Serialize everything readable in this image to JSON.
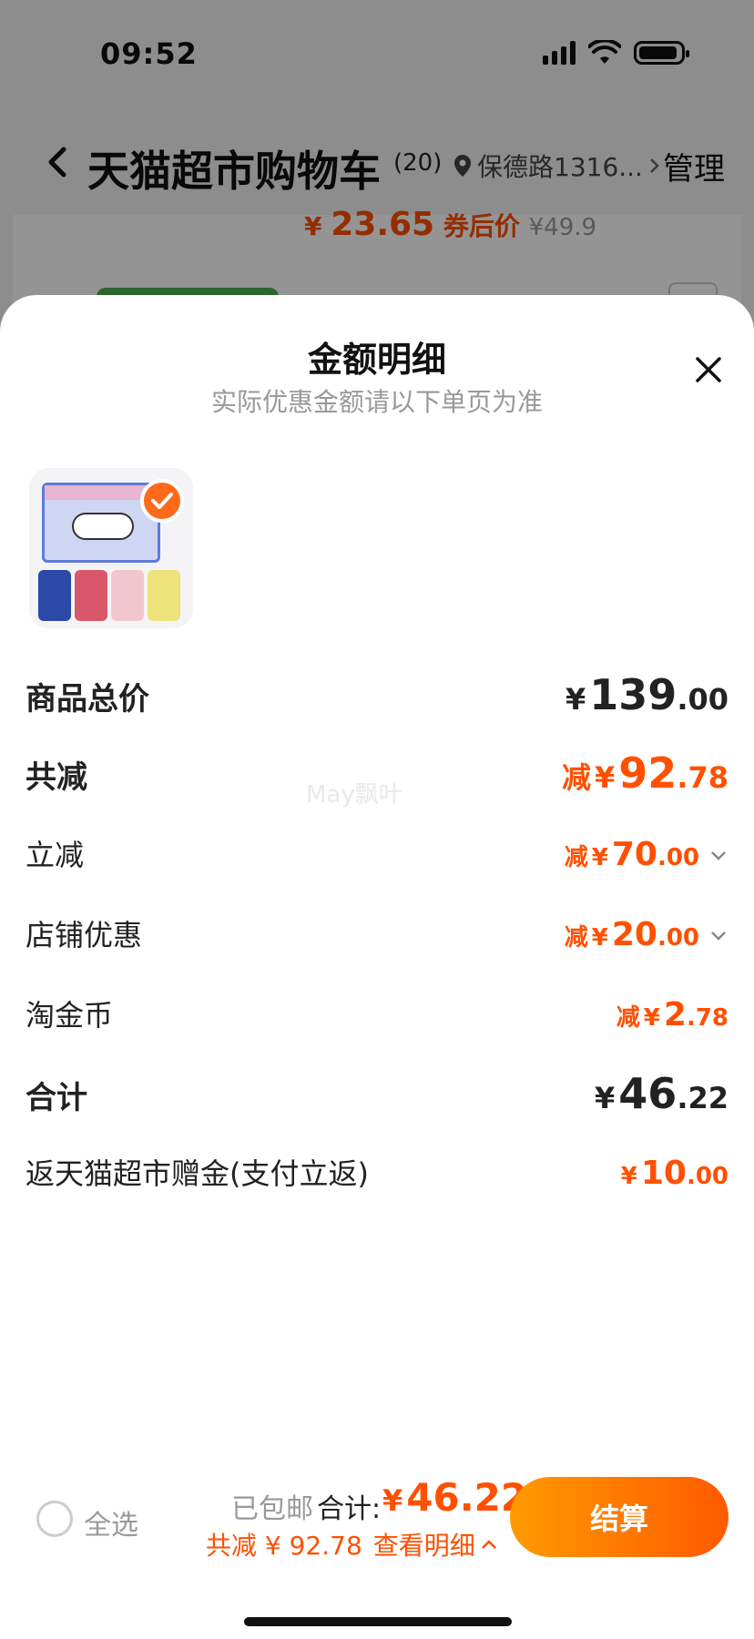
{
  "status_bar": {
    "time": "09:52"
  },
  "nav": {
    "title": "天猫超市购物车",
    "count": "(20)",
    "location": "保德路1316...",
    "manage": "管理"
  },
  "background_item": {
    "price_yen": "¥",
    "price_main": "23.65",
    "coupon_label": "券后价",
    "original_price": "¥49.9"
  },
  "sheet": {
    "title": "金额明细",
    "subtitle": "实际优惠金额请以下单页为准",
    "watermark": "May飘叶",
    "rows": [
      {
        "label": "商品总价",
        "prefix": "",
        "yen": "¥",
        "int": "139",
        "dec": ".00"
      },
      {
        "label": "共减",
        "prefix": "减",
        "yen": "¥",
        "int": "92",
        "dec": ".78"
      },
      {
        "label": "立减",
        "prefix": "减",
        "yen": "¥",
        "int": "70",
        "dec": ".00"
      },
      {
        "label": "店铺优惠",
        "prefix": "减",
        "yen": "¥",
        "int": "20",
        "dec": ".00"
      },
      {
        "label": "淘金币",
        "prefix": "减",
        "yen": "¥",
        "int": "2",
        "dec": ".78"
      },
      {
        "label": "合计",
        "prefix": "",
        "yen": "¥",
        "int": "46",
        "dec": ".22"
      },
      {
        "label": "返天猫超市赠金(支付立返)",
        "prefix": "",
        "yen": "¥",
        "int": "10",
        "dec": ".00"
      }
    ]
  },
  "bottom_bar": {
    "select_all": "全选",
    "shipping": "已包邮",
    "total_label": "合计:",
    "total_yen": "¥",
    "total_value": "46.22",
    "discount_text": "共减 ¥ 92.78",
    "view_detail": "查看明细",
    "checkout": "结算"
  },
  "colors": {
    "accent": "#ff5000",
    "button_start": "#ff9a00",
    "button_end": "#ff5a00"
  }
}
